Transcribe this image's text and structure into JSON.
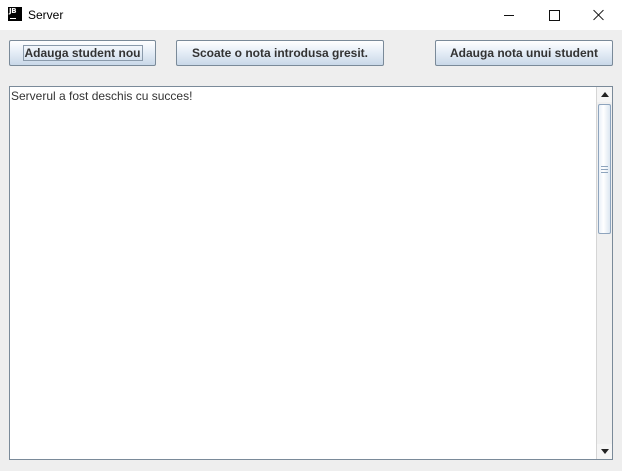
{
  "window": {
    "title": "Server",
    "icon": "jetbrains-app-icon",
    "icon_text": "JB",
    "controls": [
      "minimize-icon",
      "maximize-icon",
      "close-icon"
    ]
  },
  "toolbar": {
    "add_student_label": "Adauga student nou",
    "remove_grade_label": "Scoate o nota introdusa gresit.",
    "add_grade_label": "Adauga nota unui student"
  },
  "log": {
    "text": "Serverul a fost deschis cu succes!"
  },
  "colors": {
    "window_bg": "#eeeeee",
    "button_border": "#7a8a99",
    "button_gradient_top": "#ffffff",
    "button_gradient_bottom": "#c9d8e8",
    "text": "#333333"
  }
}
